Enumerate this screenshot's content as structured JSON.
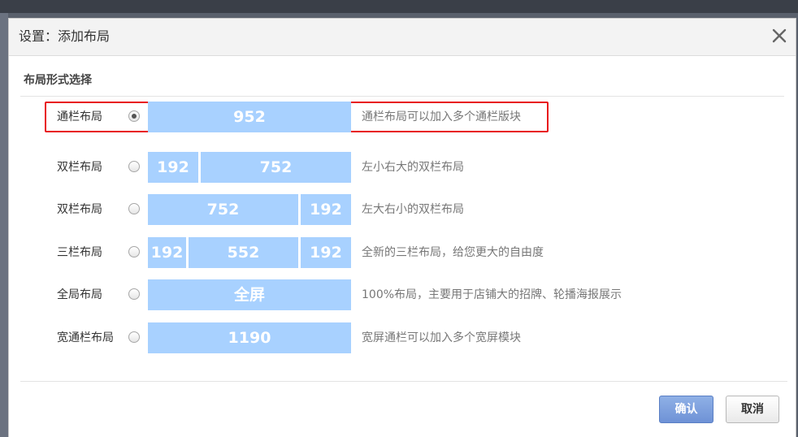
{
  "dialog": {
    "title": "设置：添加布局",
    "close_icon": "close-icon"
  },
  "section": {
    "title": "布局形式选择"
  },
  "layouts": [
    {
      "label": "通栏布局",
      "checked": true,
      "blocks": [
        "952"
      ],
      "description": "通栏布局可以加入多个通栏版块"
    },
    {
      "label": "双栏布局",
      "checked": false,
      "blocks": [
        "192",
        "752"
      ],
      "description": "左小右大的双栏布局"
    },
    {
      "label": "双栏布局",
      "checked": false,
      "blocks": [
        "752",
        "192"
      ],
      "description": "左大右小的双栏布局"
    },
    {
      "label": "三栏布局",
      "checked": false,
      "blocks": [
        "192",
        "552",
        "192"
      ],
      "description": "全新的三栏布局，给您更大的自由度"
    },
    {
      "label": "全局布局",
      "checked": false,
      "blocks": [
        "全屏"
      ],
      "description": "100%布局，主要用于店铺大的招牌、轮播海报展示"
    },
    {
      "label": "宽通栏布局",
      "checked": false,
      "blocks": [
        "1190"
      ],
      "description": "宽屏通栏可以加入多个宽屏模块"
    }
  ],
  "buttons": {
    "confirm": "确认",
    "cancel": "取消"
  },
  "colors": {
    "block_fill": "#a8d1ff",
    "selected_border": "#e8141b",
    "confirm_bg": "#7b9cdc"
  }
}
